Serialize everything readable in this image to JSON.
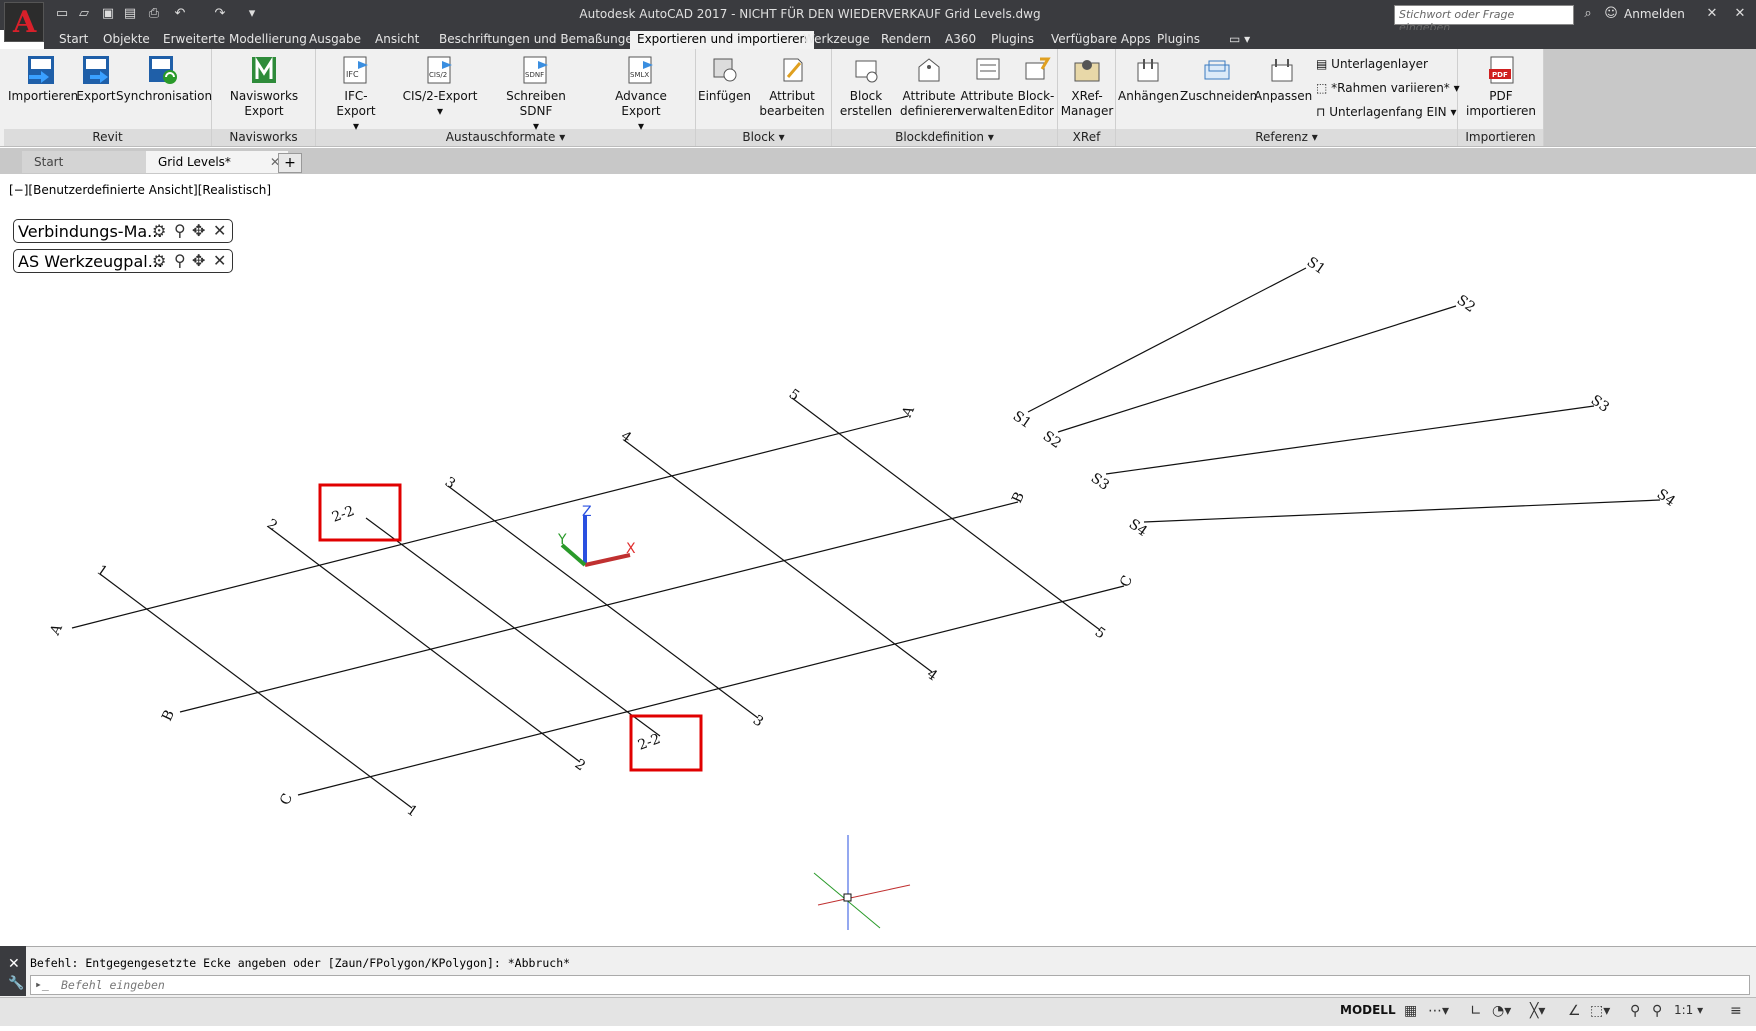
{
  "title_bar": {
    "title": "Autodesk AutoCAD 2017 - NICHT FÜR DEN WIEDERVERKAUF    Grid Levels.dwg",
    "search_placeholder": "Stichwort oder Frage eingeben",
    "login": "Anmelden",
    "app_letter": "A"
  },
  "menu_tabs": [
    "Start",
    "Objekte",
    "Erweiterte Modellierung",
    "Ausgabe",
    "Ansicht",
    "Beschriftungen und Bemaßungen",
    "Exportieren und importieren",
    "Werkzeuge",
    "Rendern",
    "A360",
    "Plugins",
    "Verfügbare Apps",
    "Plugins"
  ],
  "active_tab": "Exportieren und importieren",
  "ribbon": {
    "panels": [
      {
        "title": "Revit",
        "buttons": [
          "Importieren",
          "Export",
          "Synchronisation"
        ]
      },
      {
        "title": "Navisworks",
        "buttons": [
          "Navisworks Export"
        ]
      },
      {
        "title": "Austauschformate",
        "buttons": [
          "IFC-Export",
          "CIS/2-Export",
          "Schreiben SDNF",
          "Advance Export"
        ]
      },
      {
        "title": "Block",
        "buttons": [
          "Einfügen",
          "Attribut bearbeiten"
        ]
      },
      {
        "title": "Blockdefinition",
        "buttons": [
          "Block erstellen",
          "Attribute definieren",
          "Attribute verwalten",
          "Block-Editor"
        ]
      },
      {
        "title": "XRef",
        "buttons": [
          "XRef-Manager"
        ]
      },
      {
        "title": "Referenz",
        "buttons": [
          "Anhängen",
          "Zuschneiden",
          "Anpassen"
        ],
        "small": [
          "Unterlagenlayer",
          "*Rahmen variieren*",
          "Unterlagenfang EIN"
        ]
      },
      {
        "title": "Importieren",
        "buttons": [
          "PDF importieren"
        ]
      }
    ],
    "icon_labels": {
      "ifc": "IFC",
      "cis": "CIS/2",
      "sdnf": "SDNF",
      "smlx": "SMLX",
      "pdf": "PDF"
    }
  },
  "doc_tabs": [
    "Start",
    "Grid Levels*"
  ],
  "viewport": {
    "view_label": "[−][Benutzerdefinierte Ansicht][Realistisch]",
    "palettes": [
      "Verbindungs-Ma...",
      "AS Werkzeugpal..."
    ],
    "grid_labels": {
      "rows": [
        "A",
        "B",
        "C"
      ],
      "cols": [
        "1",
        "2",
        "2-2",
        "3",
        "4",
        "5"
      ],
      "slants": [
        "S1",
        "S2",
        "S3",
        "S4"
      ]
    },
    "ucs": {
      "x": "X",
      "y": "Y",
      "z": "Z"
    }
  },
  "command_line": {
    "history": "Befehl: Entgegengesetzte Ecke angeben oder [Zaun/FPolygon/KPolygon]: *Abbruch*",
    "placeholder": "Befehl eingeben"
  },
  "status_bar": {
    "mode": "MODELL",
    "scale": "1:1"
  },
  "colors": {
    "title_bg": "#3a3b3f",
    "ribbon_bg": "#f0f0f0",
    "highlight_box": "#e00000",
    "axis_x": "#e03030",
    "axis_y": "#2a9a2a",
    "axis_z": "#2a50e0"
  }
}
